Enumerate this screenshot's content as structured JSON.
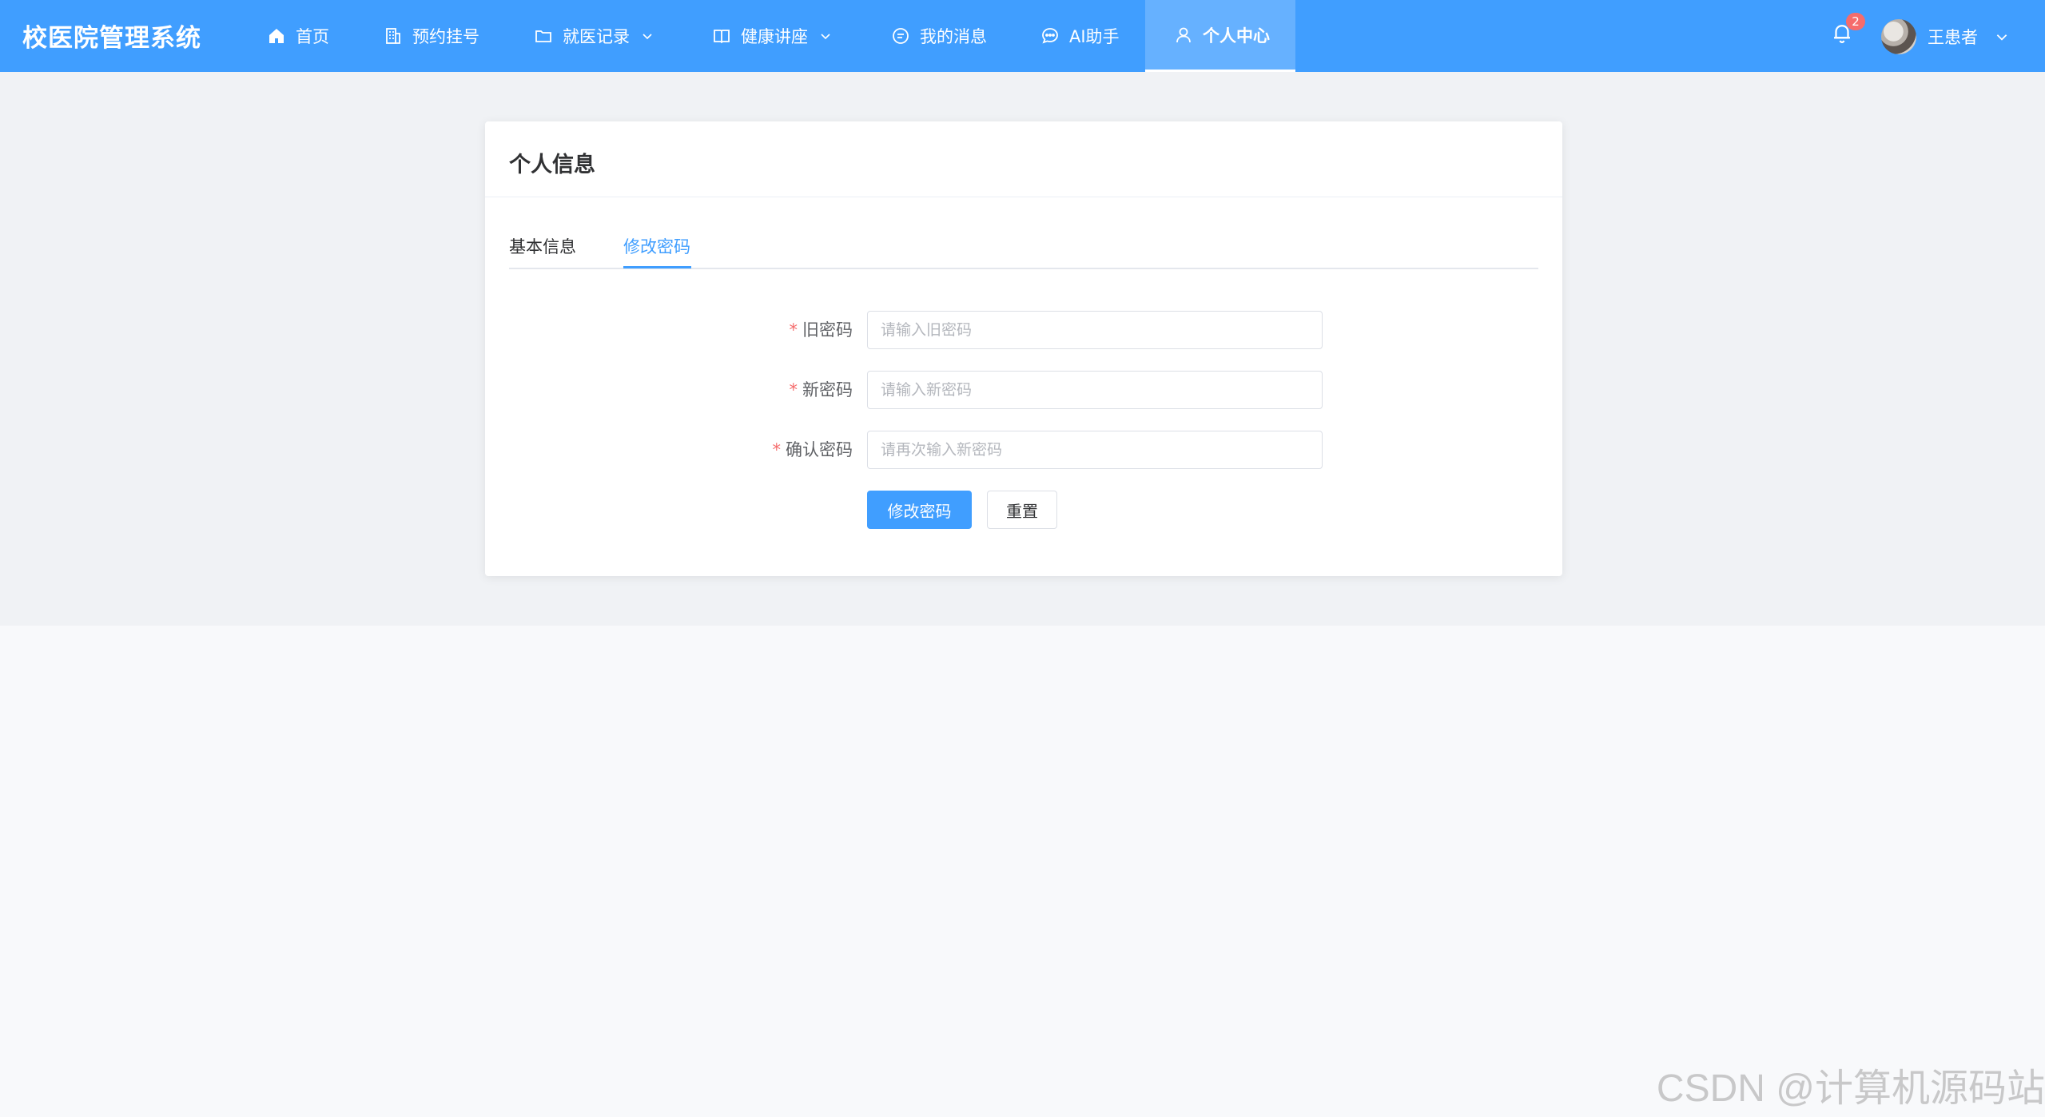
{
  "header": {
    "brand": "校医院管理系统",
    "nav": [
      {
        "label": "首页",
        "icon": "home-icon"
      },
      {
        "label": "预约挂号",
        "icon": "building-icon"
      },
      {
        "label": "就医记录",
        "icon": "folder-icon",
        "has_dropdown": true
      },
      {
        "label": "健康讲座",
        "icon": "book-icon",
        "has_dropdown": true
      },
      {
        "label": "我的消息",
        "icon": "message-icon"
      },
      {
        "label": "AI助手",
        "icon": "chat-icon"
      },
      {
        "label": "个人中心",
        "icon": "user-icon",
        "active": true
      }
    ],
    "notification_count": "2",
    "username": "王患者"
  },
  "card": {
    "title": "个人信息",
    "tabs": [
      {
        "label": "基本信息"
      },
      {
        "label": "修改密码",
        "active": true
      }
    ]
  },
  "form": {
    "old_password": {
      "label": "旧密码",
      "placeholder": "请输入旧密码"
    },
    "new_password": {
      "label": "新密码",
      "placeholder": "请输入新密码"
    },
    "confirm_password": {
      "label": "确认密码",
      "placeholder": "请再次输入新密码"
    },
    "submit_label": "修改密码",
    "reset_label": "重置"
  },
  "watermark": "CSDN @计算机源码站",
  "colors": {
    "primary": "#409eff",
    "active_nav": "#66b1ff",
    "required": "#f56c6c",
    "badge": "#f56c6c"
  }
}
